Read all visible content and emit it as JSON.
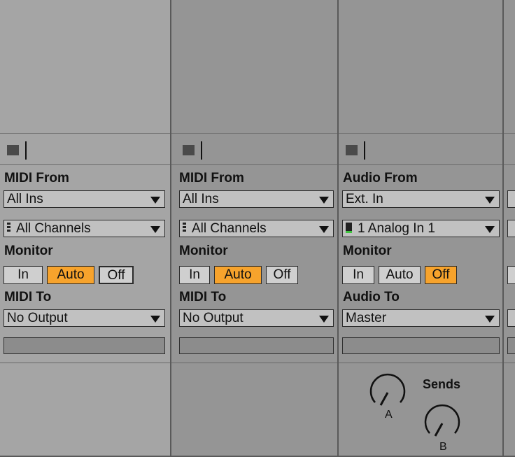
{
  "tracks": [
    {
      "input_label": "MIDI From",
      "input_type": "All Ins",
      "input_channel": "All Channels",
      "monitor_label": "Monitor",
      "monitor_in": "In",
      "monitor_auto": "Auto",
      "monitor_off": "Off",
      "monitor_selected": "Auto",
      "output_label": "MIDI To",
      "output_type": "No Output"
    },
    {
      "input_label": "MIDI From",
      "input_type": "All Ins",
      "input_channel": "All Channels",
      "monitor_label": "Monitor",
      "monitor_in": "In",
      "monitor_auto": "Auto",
      "monitor_off": "Off",
      "monitor_selected": "Auto",
      "output_label": "MIDI To",
      "output_type": "No Output"
    },
    {
      "input_label": "Audio From",
      "input_type": "Ext. In",
      "input_channel": "1 Analog In 1",
      "monitor_label": "Monitor",
      "monitor_in": "In",
      "monitor_auto": "Auto",
      "monitor_off": "Off",
      "monitor_selected": "Off",
      "output_label": "Audio To",
      "output_type": "Master",
      "sends_label": "Sends",
      "send_a": "A",
      "send_b": "B"
    }
  ],
  "colors": {
    "midi_column_bg": "#a5a5a5",
    "audio_column_bg": "#959595",
    "active_button": "#f7a32c",
    "input_meter": "#3ec43e"
  }
}
